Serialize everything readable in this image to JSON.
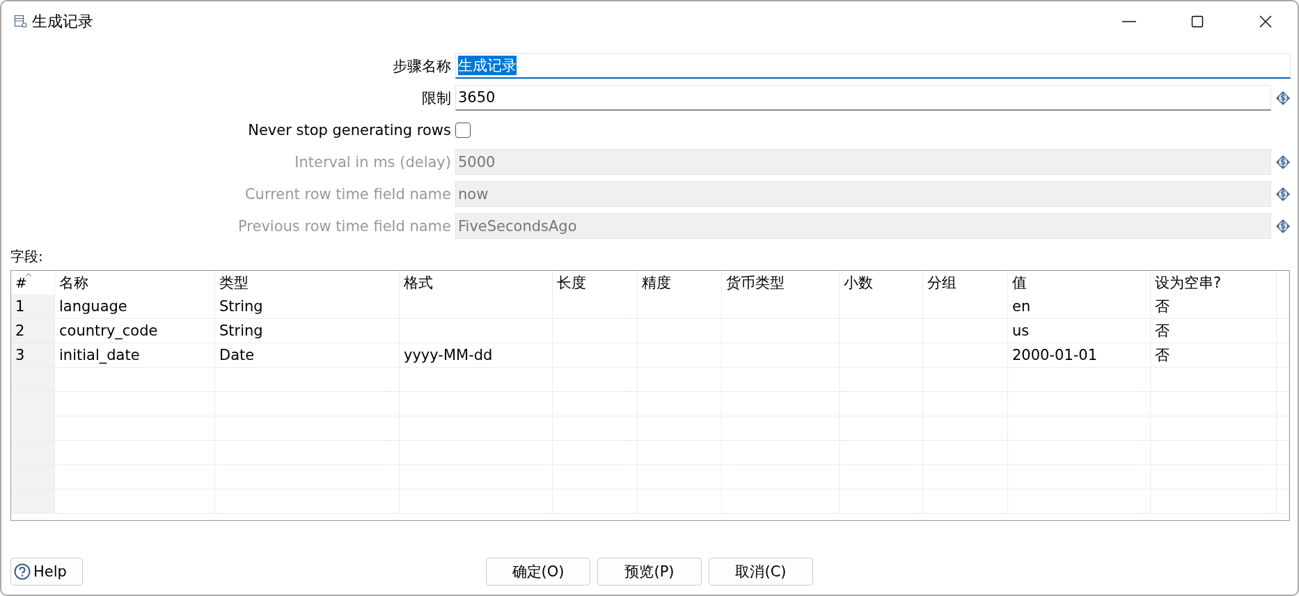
{
  "window": {
    "title": "生成记录"
  },
  "form": [
    {
      "kind": "text",
      "label": "步骤名称",
      "value": "生成记录",
      "disabled": false,
      "focused": true,
      "value_selected": true,
      "variable": false
    },
    {
      "kind": "text",
      "label": "限制",
      "value": "3650",
      "disabled": false,
      "focused": false,
      "value_selected": false,
      "variable": true
    },
    {
      "kind": "checkbox",
      "label": "Never stop generating rows",
      "checked": false,
      "disabled": false
    },
    {
      "kind": "text",
      "label": "Interval in ms (delay)",
      "value": "5000",
      "disabled": true,
      "focused": false,
      "value_selected": false,
      "variable": true
    },
    {
      "kind": "text",
      "label": "Current row time field name",
      "value": "now",
      "disabled": true,
      "focused": false,
      "value_selected": false,
      "variable": true
    },
    {
      "kind": "text",
      "label": "Previous row time field name",
      "value": "FiveSecondsAgo",
      "disabled": true,
      "focused": false,
      "value_selected": false,
      "variable": true
    }
  ],
  "fields_label": "字段:",
  "table": {
    "columns": [
      "#",
      "名称",
      "类型",
      "格式",
      "长度",
      "精度",
      "货币类型",
      "小数",
      "分组",
      "值",
      "设为空串?"
    ],
    "rows": [
      [
        "1",
        "language",
        "String",
        "",
        "",
        "",
        "",
        "",
        "",
        "en",
        "否"
      ],
      [
        "2",
        "country_code",
        "String",
        "",
        "",
        "",
        "",
        "",
        "",
        "us",
        "否"
      ],
      [
        "3",
        "initial_date",
        "Date",
        "yyyy-MM-dd",
        "",
        "",
        "",
        "",
        "",
        "2000-01-01",
        "否"
      ]
    ]
  },
  "help_button": "Help",
  "buttons": [
    "确定(O)",
    "预览(P)",
    "取消(C)"
  ]
}
